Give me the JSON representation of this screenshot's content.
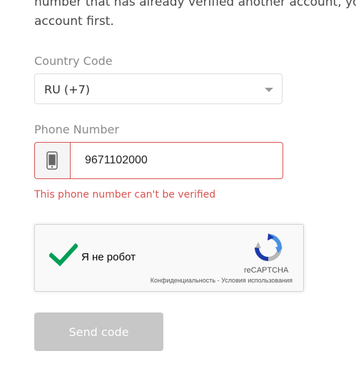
{
  "intro": {
    "line1": "number that has already verified another account, you",
    "line2": "account first."
  },
  "country": {
    "label": "Country Code",
    "selected": "RU (+7)"
  },
  "phone": {
    "label": "Phone Number",
    "value": "9671102000",
    "icon": "mobile-phone-icon",
    "error": "This phone number can't be verified"
  },
  "recaptcha": {
    "checkbox_label": "Я не робот",
    "brand": "reCAPTCHA",
    "privacy_link": "Конфиденциальность",
    "separator": " - ",
    "terms_link": "Условия использования",
    "checked": true
  },
  "send_button": {
    "label": "Send code"
  },
  "colors": {
    "error": "#d9534f",
    "check_green": "#009e55",
    "button_disabled": "#c7c7c7"
  }
}
